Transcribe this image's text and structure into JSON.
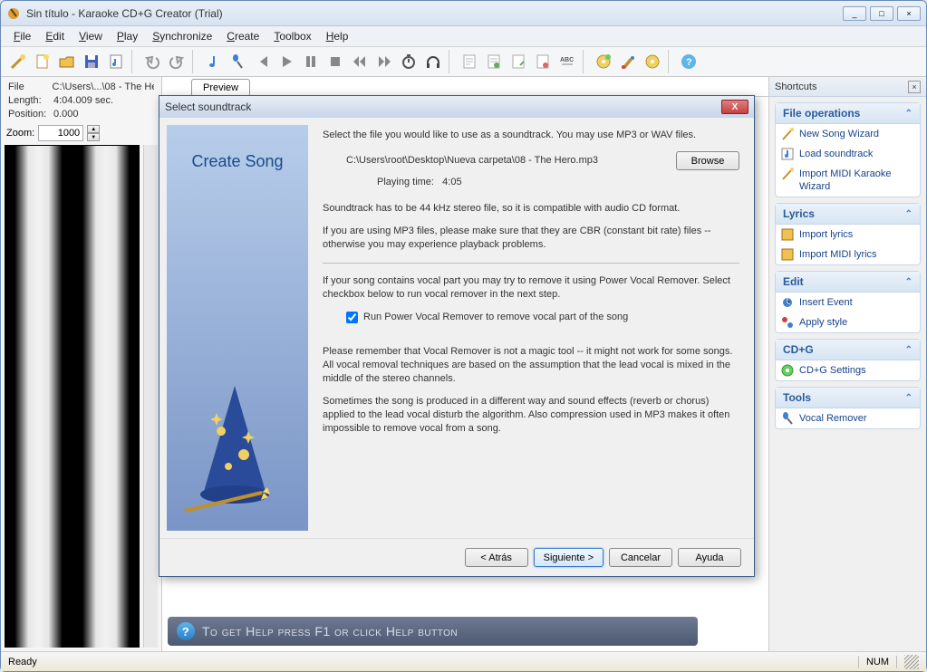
{
  "window": {
    "title": "Sin título - Karaoke CD+G Creator (Trial)",
    "buttons": {
      "min": "_",
      "max": "□",
      "close": "×"
    }
  },
  "menubar": [
    "File",
    "Edit",
    "View",
    "Play",
    "Synchronize",
    "Create",
    "Toolbox",
    "Help"
  ],
  "info": {
    "file_lbl": "File",
    "file_val": "C:\\Users\\...\\08 - The He",
    "length_lbl": "Length:",
    "length_val": "4:04.009 sec.",
    "position_lbl": "Position:",
    "position_val": "0.000",
    "zoom_lbl": "Zoom:",
    "zoom_val": "1000"
  },
  "tabs": {
    "preview": "Preview"
  },
  "helpstrip": "To get Help press F1 or click Help button",
  "shortcuts": {
    "title": "Shortcuts",
    "sections": [
      {
        "title": "File operations",
        "items": [
          "New Song Wizard",
          "Load soundtrack",
          "Import MIDI Karaoke Wizard"
        ]
      },
      {
        "title": "Lyrics",
        "items": [
          "Import lyrics",
          "Import MIDI lyrics"
        ]
      },
      {
        "title": "Edit",
        "items": [
          "Insert Event",
          "Apply style"
        ]
      },
      {
        "title": "CD+G",
        "items": [
          "CD+G Settings"
        ]
      },
      {
        "title": "Tools",
        "items": [
          "Vocal Remover"
        ]
      }
    ]
  },
  "status": {
    "left": "Ready",
    "num": "NUM"
  },
  "dialog": {
    "title": "Select soundtrack",
    "side_title": "Create Song",
    "intro": "Select the file you would like to use as a soundtrack. You may use MP3 or WAV files.",
    "path": "C:\\Users\\root\\Desktop\\Nueva carpeta\\08 - The Hero.mp3",
    "browse": "Browse",
    "playtime_lbl": "Playing time:",
    "playtime_val": "4:05",
    "note1": "Soundtrack has to be 44 kHz stereo file, so it is compatible with audio CD format.",
    "note2": "If you are using MP3 files, please make sure that they are CBR (constant bit rate) files -- otherwise you may experience playback problems.",
    "vocal_intro": "If your song contains vocal part you may try to remove it using Power Vocal Remover. Select checkbox below to run vocal remover in the next step.",
    "checkbox_label": "Run Power Vocal Remover to remove vocal part of the song",
    "disclaimer1": "Please remember that Vocal Remover is not a magic tool -- it might not work for some songs. All vocal removal techniques are based on the assumption that the lead vocal is mixed in the middle of the stereo channels.",
    "disclaimer2": "Sometimes the song is produced in a different way and sound effects (reverb or chorus) applied to the lead vocal disturb the algorithm. Also compression used in MP3 makes it often impossible to remove vocal from a song.",
    "buttons": {
      "back": "< Atrás",
      "next": "Siguiente >",
      "cancel": "Cancelar",
      "help": "Ayuda"
    }
  },
  "toolbar_icons": [
    "wand",
    "new",
    "open",
    "save",
    "music-note",
    "undo",
    "redo",
    "note",
    "mic",
    "skip-start",
    "play",
    "pause",
    "stop",
    "rewind",
    "forward",
    "timer",
    "headphones",
    "doc-a",
    "doc-b",
    "doc-c",
    "doc-d",
    "abc",
    "disc-a",
    "brush",
    "disc-b",
    "help"
  ]
}
